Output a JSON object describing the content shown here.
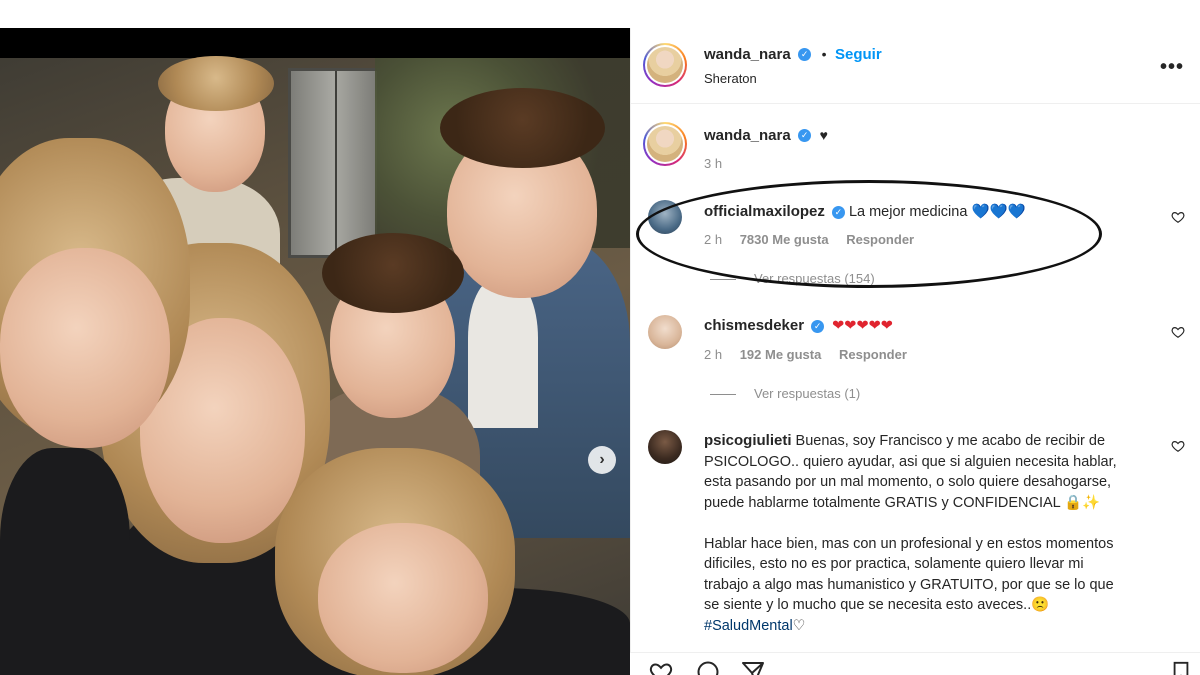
{
  "post": {
    "author": "wanda_nara",
    "follow_label": "Seguir",
    "separator": "•",
    "location": "Sheraton",
    "more_label": "•••",
    "caption_symbol": "♥",
    "caption_time": "3 h"
  },
  "comments": [
    {
      "username": "officialmaxilopez",
      "text": "La mejor medicina",
      "emoji": "💙💙💙",
      "time": "2 h",
      "likes": "7830 Me gusta",
      "reply_label": "Responder",
      "view_replies": "Ver respuestas (154)"
    },
    {
      "username": "chismesdeker",
      "emoji": "❤❤❤❤❤",
      "time": "2 h",
      "likes": "192 Me gusta",
      "reply_label": "Responder",
      "view_replies": "Ver respuestas (1)"
    },
    {
      "username": "psicogiulieti",
      "lines": [
        "Buenas, soy Francisco y me acabo de recibir de",
        "PSICOLOGO.. quiero ayudar, asi que si alguien necesita hablar,",
        "esta pasando por un mal momento, o solo quiere desahogarse,",
        "puede hablarme totalmente GRATIS y CONFIDENCIAL 🔒✨",
        "",
        "Hablar hace bien, mas con un profesional y en estos momentos",
        "dificiles, esto no es por practica, solamente quiero llevar mi",
        "trabajo a algo mas humanistico y GRATUITO, por que se lo que",
        "se siente y lo mucho que se necesita esto aveces..🙁"
      ],
      "hashtag": "#SaludMental",
      "hashtag_suffix": "♡"
    }
  ],
  "icons": [
    "heart-icon",
    "comment-icon",
    "share-icon",
    "bookmark-icon",
    "chevron-right-icon",
    "verified-badge-icon"
  ],
  "colors": {
    "link": "#0095f6",
    "verified": "#3897f0",
    "annotation_oval": "#111111"
  }
}
